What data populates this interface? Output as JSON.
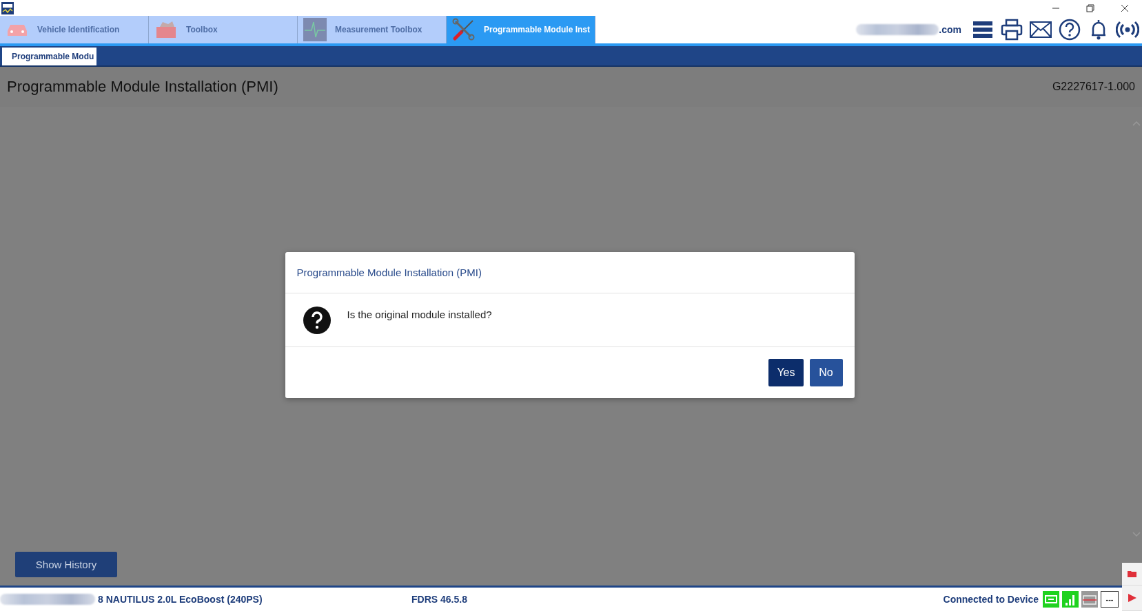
{
  "tabs": [
    {
      "label": "Vehicle Identification",
      "selected": false,
      "kind": "car"
    },
    {
      "label": "Toolbox",
      "selected": false,
      "kind": "toolbox"
    },
    {
      "label": "Measurement Toolbox",
      "selected": false,
      "kind": "wave"
    },
    {
      "label": "Programmable Module Inst",
      "selected": true,
      "kind": "tools"
    }
  ],
  "account": {
    "email_suffix": ".com"
  },
  "subtabs": [
    {
      "label": "Programmable Modu",
      "selected": true
    }
  ],
  "page": {
    "title": "Programmable Module Installation (PMI)",
    "code": "G2227617-1.000"
  },
  "dialog": {
    "title": "Programmable Module Installation (PMI)",
    "message": "Is the original module installed?",
    "buttons": [
      {
        "label": "Yes",
        "focused": true
      },
      {
        "label": "No",
        "focused": false
      }
    ]
  },
  "show_history": "Show History",
  "status_bar": {
    "vehicle": "8 NAUTILUS 2.0L EcoBoost (240PS)",
    "version": "FDRS 46.5.8",
    "connection": "Connected to Device",
    "battery_box": "---"
  }
}
